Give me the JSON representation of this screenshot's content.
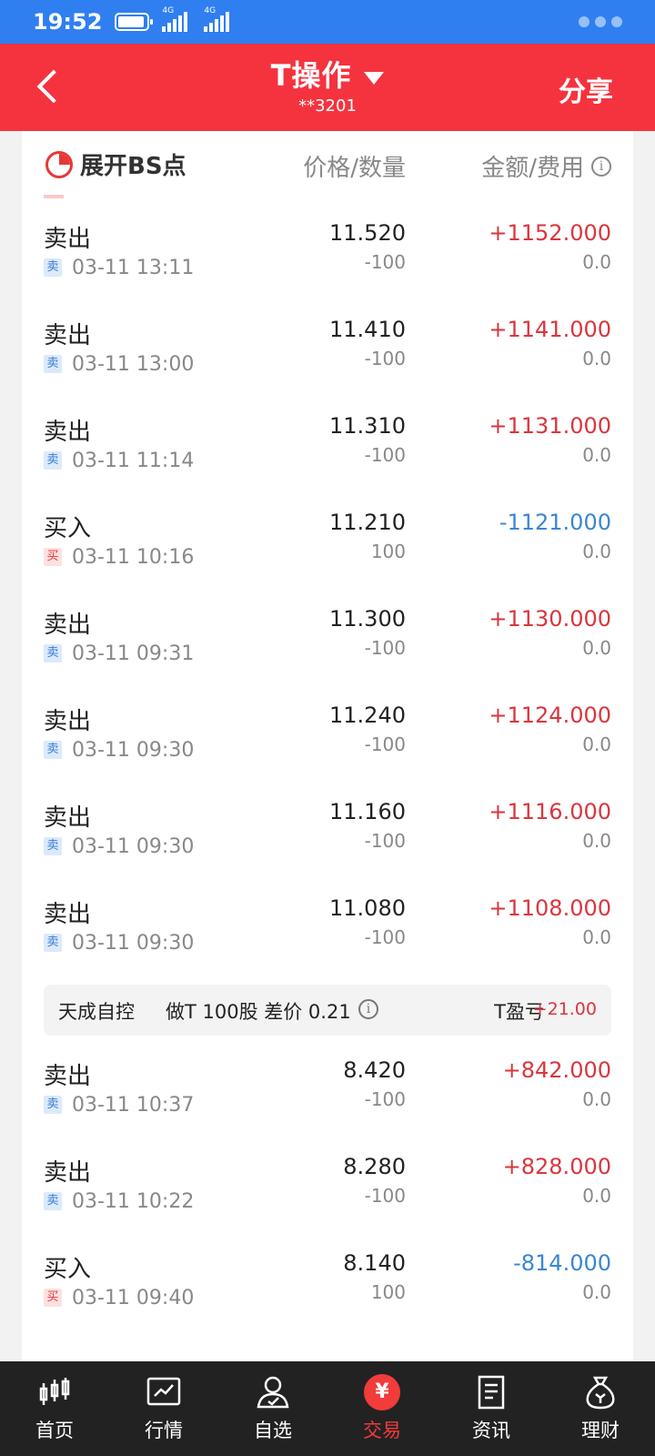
{
  "status_bar": {
    "time": "19:52",
    "net1": "4G",
    "net2": "4G"
  },
  "header": {
    "title": "T操作",
    "account": "**3201",
    "share": "分享"
  },
  "columns": {
    "bs_toggle": "展开BS点",
    "price_qty": "价格/数量",
    "amount_fee": "金额/费用"
  },
  "group1": [
    {
      "type": "卖出",
      "badge": "卖",
      "time": "03-11 13:11",
      "price": "11.520",
      "qty": "-100",
      "amount": "+1152.000",
      "fee": "0.0"
    },
    {
      "type": "卖出",
      "badge": "卖",
      "time": "03-11 13:00",
      "price": "11.410",
      "qty": "-100",
      "amount": "+1141.000",
      "fee": "0.0"
    },
    {
      "type": "卖出",
      "badge": "卖",
      "time": "03-11 11:14",
      "price": "11.310",
      "qty": "-100",
      "amount": "+1131.000",
      "fee": "0.0"
    },
    {
      "type": "买入",
      "badge": "买",
      "time": "03-11 10:16",
      "price": "11.210",
      "qty": "100",
      "amount": "-1121.000",
      "fee": "0.0"
    },
    {
      "type": "卖出",
      "badge": "卖",
      "time": "03-11 09:31",
      "price": "11.300",
      "qty": "-100",
      "amount": "+1130.000",
      "fee": "0.0"
    },
    {
      "type": "卖出",
      "badge": "卖",
      "time": "03-11 09:30",
      "price": "11.240",
      "qty": "-100",
      "amount": "+1124.000",
      "fee": "0.0"
    },
    {
      "type": "卖出",
      "badge": "卖",
      "time": "03-11 09:30",
      "price": "11.160",
      "qty": "-100",
      "amount": "+1116.000",
      "fee": "0.0"
    },
    {
      "type": "卖出",
      "badge": "卖",
      "time": "03-11 09:30",
      "price": "11.080",
      "qty": "-100",
      "amount": "+1108.000",
      "fee": "0.0"
    }
  ],
  "group2_header": {
    "stock": "天成自控",
    "detail": "做T 100股 差价 0.21",
    "pl_label": "T盈亏",
    "pl_value": "+21.00"
  },
  "group2": [
    {
      "type": "卖出",
      "badge": "卖",
      "time": "03-11 10:37",
      "price": "8.420",
      "qty": "-100",
      "amount": "+842.000",
      "fee": "0.0"
    },
    {
      "type": "卖出",
      "badge": "卖",
      "time": "03-11 10:22",
      "price": "8.280",
      "qty": "-100",
      "amount": "+828.000",
      "fee": "0.0"
    },
    {
      "type": "买入",
      "badge": "买",
      "time": "03-11 09:40",
      "price": "8.140",
      "qty": "100",
      "amount": "-814.000",
      "fee": "0.0"
    }
  ],
  "tabs": [
    {
      "label": "首页",
      "icon": "candlestick-icon"
    },
    {
      "label": "行情",
      "icon": "chart-icon"
    },
    {
      "label": "自选",
      "icon": "user-check-icon"
    },
    {
      "label": "交易",
      "icon": "yuan-icon",
      "glyph": "¥",
      "active": true
    },
    {
      "label": "资讯",
      "icon": "document-icon"
    },
    {
      "label": "理财",
      "icon": "money-bag-icon"
    }
  ],
  "colors": {
    "header_red": "#f5333f",
    "status_blue": "#2f7ff0",
    "positive": "#d9363e",
    "negative": "#3a86d4"
  }
}
